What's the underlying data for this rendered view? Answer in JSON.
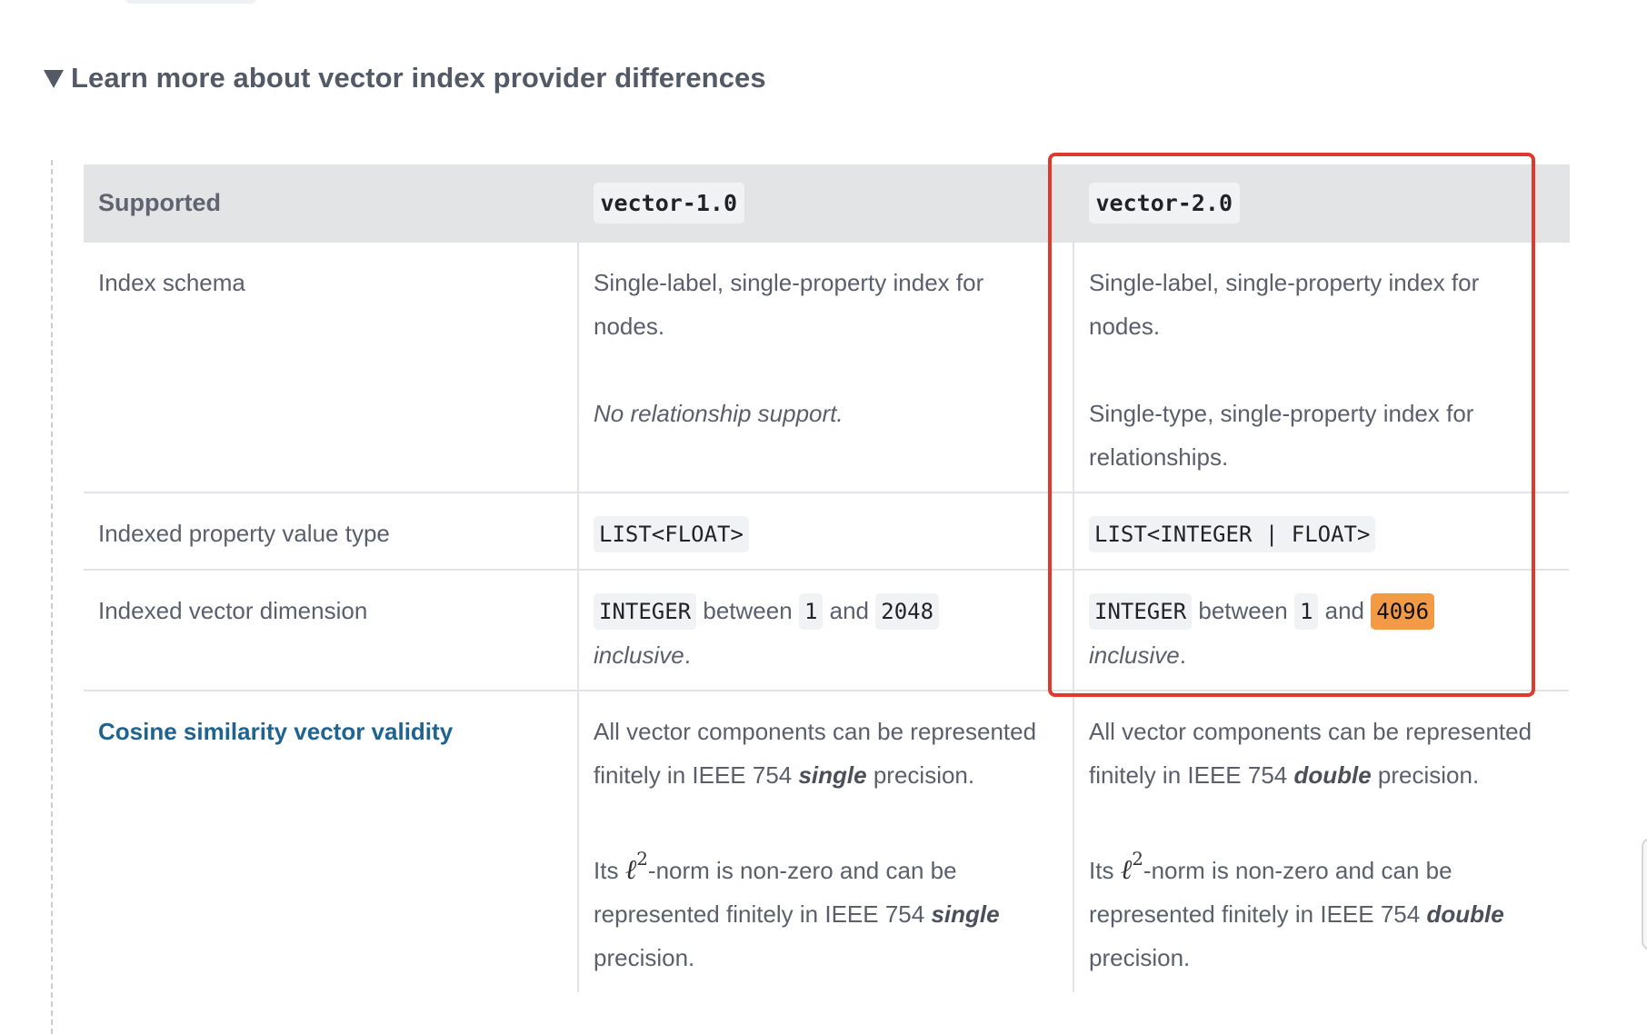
{
  "details": {
    "summary": "Learn more about vector index provider differences"
  },
  "table": {
    "headers": {
      "supported": "Supported",
      "v1": "vector-1.0",
      "v2": "vector-2.0"
    },
    "rows": {
      "index_schema": {
        "label": "Index schema",
        "v1_p1": "Single-label, single-property index for nodes.",
        "v1_p2": "No relationship support.",
        "v2_p1": "Single-label, single-property index for nodes.",
        "v2_p2": "Single-type, single-property index for relationships."
      },
      "value_type": {
        "label": "Indexed property value type",
        "v1": "LIST<FLOAT>",
        "v2": "LIST<INTEGER | FLOAT>"
      },
      "dimension": {
        "label": "Indexed vector dimension",
        "integer": "INTEGER",
        "between": "between",
        "and": "and",
        "min": "1",
        "v1_max": "2048",
        "v2_max": "4096",
        "inclusive": "inclusive",
        "period": "."
      },
      "cosine": {
        "label": "Cosine similarity vector validity",
        "p1_text": "All vector components can be represented finitely in IEEE 754",
        "precision": "precision.",
        "v1_precision_word": "single",
        "v2_precision_word": "double",
        "its": "Its",
        "norm_symbol": "ℓ",
        "norm_exponent": "2",
        "p2_text": "-norm is non-zero and can be represented finitely in IEEE 754"
      }
    }
  },
  "annotation": {
    "highlight_color": "#f29a45",
    "box_color": "#e03a2f",
    "link_color": "#1f6391"
  }
}
